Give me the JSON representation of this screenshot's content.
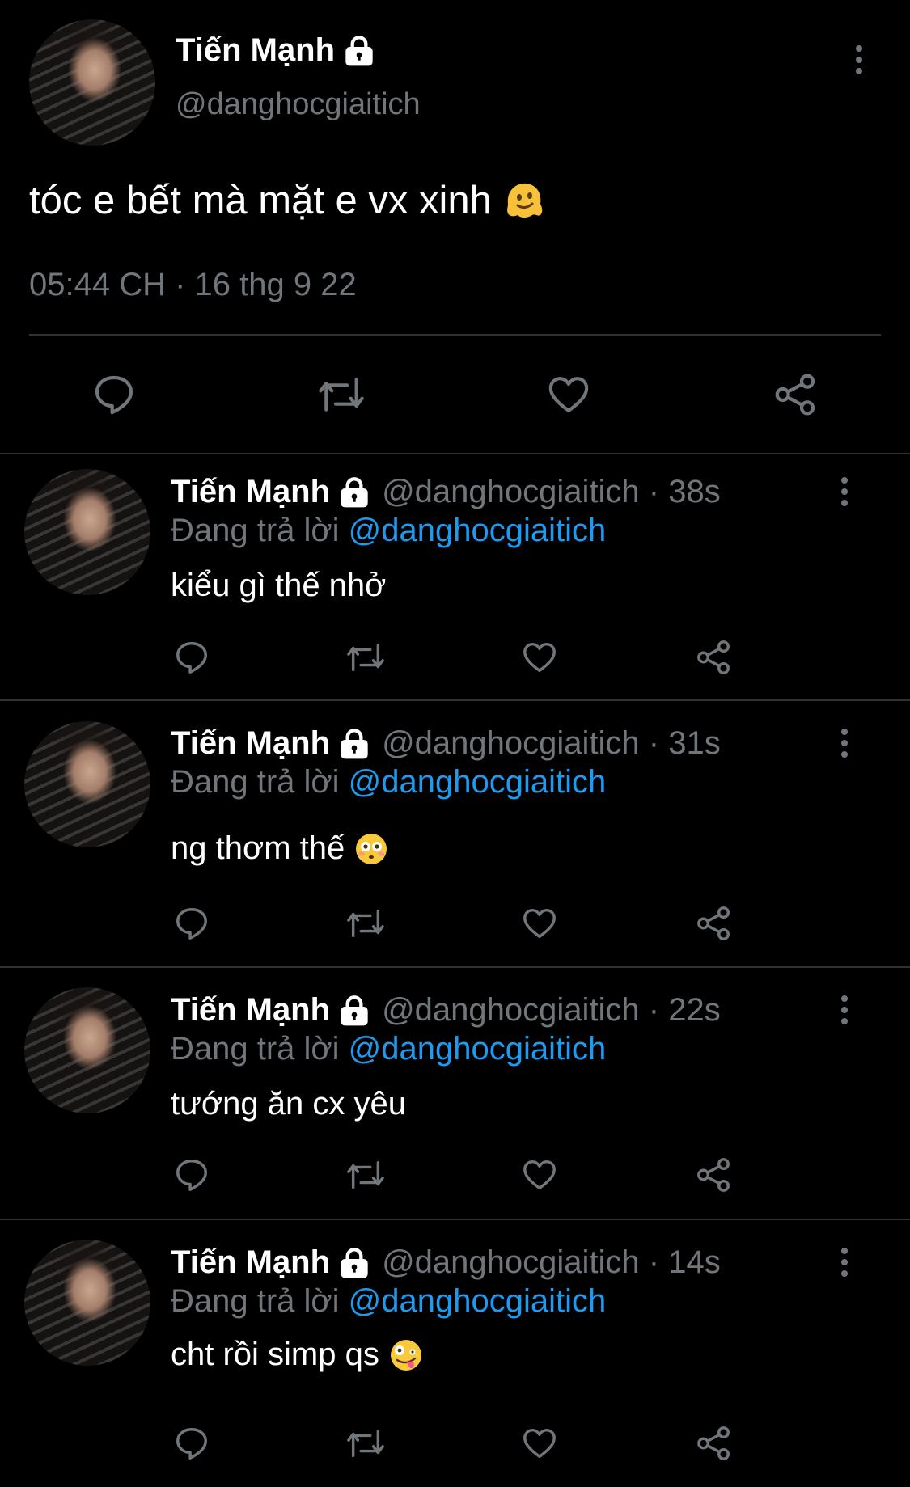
{
  "main_tweet": {
    "name": "Tiến Mạnh",
    "handle": "@danghocgiaitich",
    "text": "tóc e bết mà mặt e vx xinh",
    "emoji": "melting-face-emoji",
    "timestamp": "05:44 CH · 16 thg 9 22"
  },
  "replies": [
    {
      "name": "Tiến Mạnh",
      "handle_time": "@danghocgiaitich · 38s",
      "replying_to_prefix": "Đang trả lời",
      "replying_to_handle": "@danghocgiaitich",
      "text": "kiểu gì thế nhở",
      "emoji": ""
    },
    {
      "name": "Tiến Mạnh",
      "handle_time": "@danghocgiaitich · 31s",
      "replying_to_prefix": "Đang trả lời",
      "replying_to_handle": "@danghocgiaitich",
      "text": "ng thơm thế",
      "emoji": "flushed-face-emoji"
    },
    {
      "name": "Tiến Mạnh",
      "handle_time": "@danghocgiaitich · 22s",
      "replying_to_prefix": "Đang trả lời",
      "replying_to_handle": "@danghocgiaitich",
      "text": "tướng ăn cx yêu",
      "emoji": ""
    },
    {
      "name": "Tiến Mạnh",
      "handle_time": "@danghocgiaitich · 14s",
      "replying_to_prefix": "Đang trả lời",
      "replying_to_handle": "@danghocgiaitich",
      "text": "cht rồi simp qs",
      "emoji": "zany-face-emoji"
    }
  ],
  "icons": {
    "reply": "reply-icon",
    "retweet": "retweet-icon",
    "like": "heart-icon",
    "share": "share-icon",
    "lock": "lock-icon",
    "more": "more-vertical-icon"
  },
  "colors": {
    "background": "#000000",
    "primary_text": "#ffffff",
    "secondary_text": "#71767b",
    "mention": "#1d9bf0",
    "divider": "#2f3336"
  }
}
